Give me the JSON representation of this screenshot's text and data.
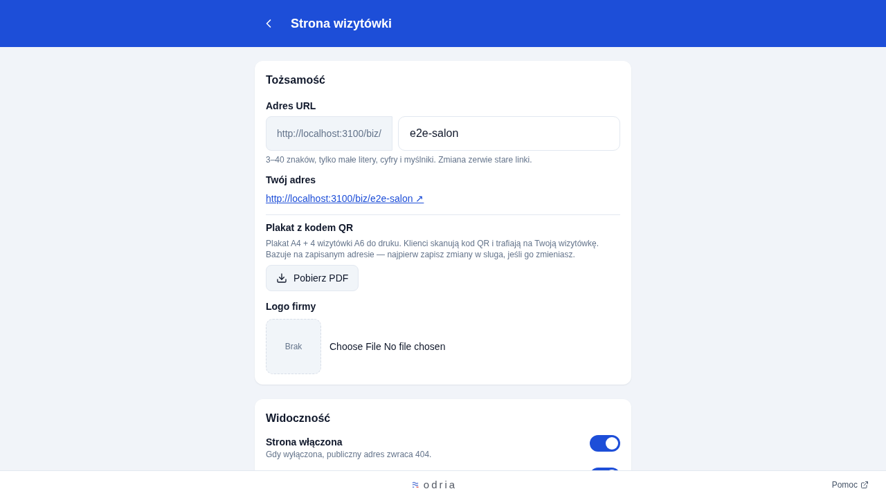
{
  "header": {
    "title": "Strona wizytówki"
  },
  "identity": {
    "title": "Tożsamość",
    "url_field": {
      "label": "Adres URL",
      "prefix": "http://localhost:3100/biz/",
      "value": "e2e-salon",
      "hint": "3–40 znaków, tylko małe litery, cyfry i myślniki. Zmiana zerwie stare linki."
    },
    "address": {
      "label": "Twój adres",
      "link": "http://localhost:3100/biz/e2e-salon ↗"
    },
    "qr_poster": {
      "title": "Plakat z kodem QR",
      "description": "Plakat A4 + 4 wizytówki A6 do druku. Klienci skanują kod QR i trafiają na Twoją wizytówkę. Bazuje na zapisanym adresie — najpierw zapisz zmiany w sluga, jeśli go zmieniasz.",
      "button": "Pobierz PDF"
    },
    "logo": {
      "label": "Logo firmy",
      "preview_text": "Brak",
      "file_button": "Choose File",
      "file_status": "No file chosen"
    }
  },
  "visibility": {
    "title": "Widoczność",
    "toggles": [
      {
        "label": "Strona włączona",
        "description": "Gdy wyłączona, publiczny adres zwraca 404.",
        "on": true
      },
      {
        "on": true
      }
    ]
  },
  "footer": {
    "logo": "odria",
    "help_link": "Pomoc"
  }
}
